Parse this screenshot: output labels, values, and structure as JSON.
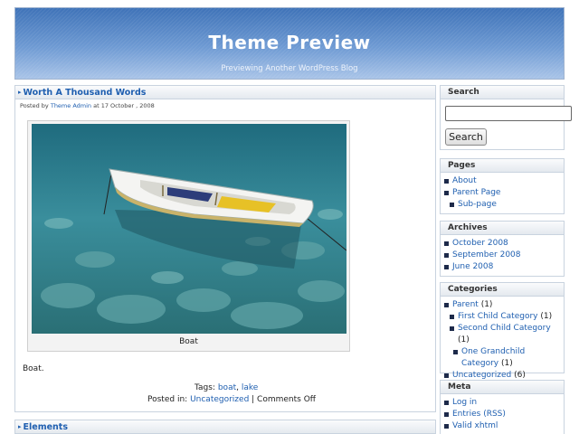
{
  "header": {
    "title": "Theme Preview",
    "description": "Previewing Another WordPress Blog"
  },
  "post1": {
    "title": "Worth A Thousand Words",
    "meta_prefix": "Posted by",
    "author": "Theme Admin",
    "meta_date": "at 17 October , 2008",
    "image_caption": "Boat",
    "body": "Boat.",
    "tags_label": "Tags:",
    "tags": [
      "boat",
      "lake"
    ],
    "posted_in_label": "Posted in:",
    "category": "Uncategorized",
    "comments": "| Comments Off"
  },
  "post2": {
    "title": "Elements"
  },
  "sidebar": {
    "search": {
      "title": "Search",
      "input_value": "",
      "button_label": "Search"
    },
    "pages": {
      "title": "Pages",
      "items": [
        "About",
        "Parent Page",
        "Sub-page"
      ]
    },
    "archives": {
      "title": "Archives",
      "items": [
        "October 2008",
        "September 2008",
        "June 2008"
      ]
    },
    "categories": {
      "title": "Categories",
      "items": [
        {
          "label": "Parent",
          "count": "(1)"
        },
        {
          "label": "First Child Category",
          "count": "(1)"
        },
        {
          "label": "Second Child Category",
          "count": "(1)"
        },
        {
          "label": "One Grandchild Category",
          "count": "(1)"
        },
        {
          "label": "Uncategorized",
          "count": "(6)"
        }
      ]
    },
    "meta": {
      "title": "Meta",
      "items": [
        "Log in",
        "Entries (RSS)",
        "Valid xhtml"
      ]
    }
  },
  "colors": {
    "link": "#1f5fb0",
    "header_blue": "#4f82c4"
  }
}
